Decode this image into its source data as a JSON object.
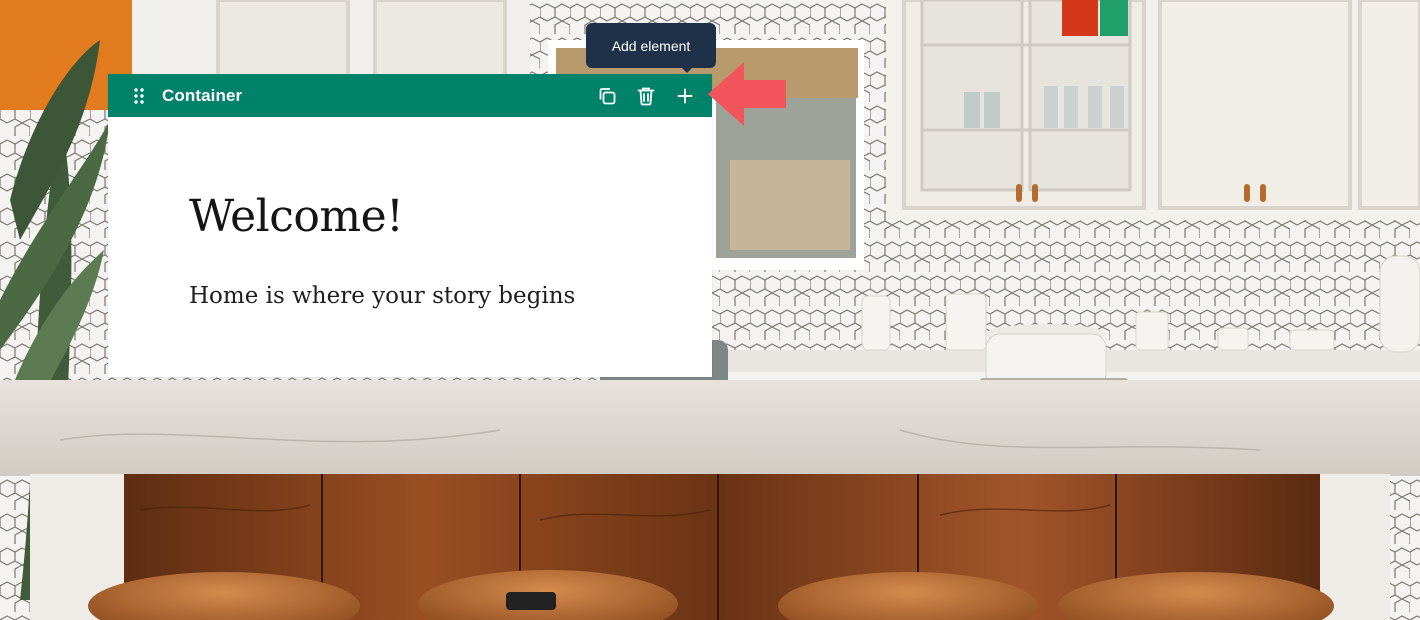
{
  "block": {
    "type_label": "Container",
    "heading": "Welcome!",
    "tagline": "Home is where your story begins"
  },
  "tooltip": {
    "text": "Add element"
  },
  "toolbar": {
    "actions": [
      "duplicate-icon",
      "trash-icon",
      "plus-icon"
    ],
    "color": "#00826a"
  },
  "colors": {
    "toolbar": "#00826a",
    "tooltip": "#1f3148",
    "pointer_arrow": "#f2545b"
  }
}
